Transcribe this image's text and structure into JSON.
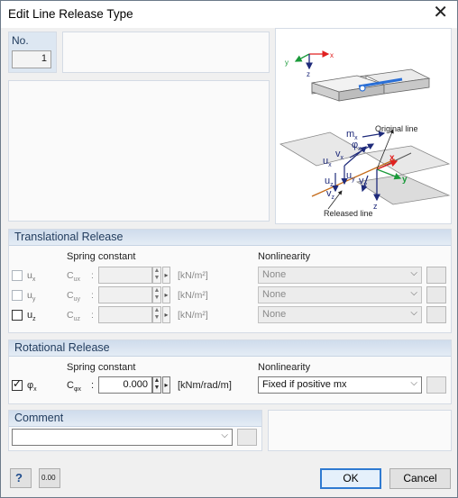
{
  "window": {
    "title": "Edit Line Release Type"
  },
  "no_section": {
    "label": "No.",
    "value": "1"
  },
  "image": {
    "labels": {
      "original_line": "Original line",
      "released_line": "Released line",
      "x": "x",
      "y": "y",
      "z": "z",
      "mx": "m",
      "mx_sub": "x",
      "phix": "φ",
      "phix_sub": "x",
      "vx": "v",
      "vx_sub": "x",
      "ux": "u",
      "ux_sub": "x",
      "uy": "u",
      "uy_sub": "y",
      "vy": "v",
      "vy_sub": "y",
      "uz": "u",
      "uz_sub": "z",
      "vz": "v",
      "vz_sub": "z"
    }
  },
  "translational": {
    "title": "Translational Release",
    "spring_header": "Spring constant",
    "nonlin_header": "Nonlinearity",
    "rows": [
      {
        "dof": "u",
        "dof_sub": "x",
        "const": "C",
        "const_sub": "ux",
        "colon": ":",
        "unit": "[kN/m²]",
        "nonlin": "None",
        "checked": false,
        "enabled": false
      },
      {
        "dof": "u",
        "dof_sub": "y",
        "const": "C",
        "const_sub": "uy",
        "colon": ":",
        "unit": "[kN/m²]",
        "nonlin": "None",
        "checked": false,
        "enabled": false
      },
      {
        "dof": "u",
        "dof_sub": "z",
        "const": "C",
        "const_sub": "uz",
        "colon": ":",
        "unit": "[kN/m²]",
        "nonlin": "None",
        "checked": false,
        "enabled": true
      }
    ]
  },
  "rotational": {
    "title": "Rotational Release",
    "spring_header": "Spring constant",
    "nonlin_header": "Nonlinearity",
    "row": {
      "dof": "φ",
      "dof_sub": "x",
      "const": "C",
      "const_sub": "φx",
      "colon": ":",
      "value": "0.000",
      "unit": "[kNm/rad/m]",
      "nonlin": "Fixed if positive mx",
      "checked": true
    }
  },
  "comment": {
    "title": "Comment",
    "value": ""
  },
  "buttons": {
    "ok": "OK",
    "cancel": "Cancel",
    "units_icon_text": "0.00"
  },
  "colors": {
    "accent": "#2f7ad1",
    "header_bg": "#dde7f2",
    "x_axis": "#e02020",
    "y_axis": "#1a9a3a",
    "z_axis": "#1e2a7a",
    "release_line": "#2a6fd6"
  }
}
